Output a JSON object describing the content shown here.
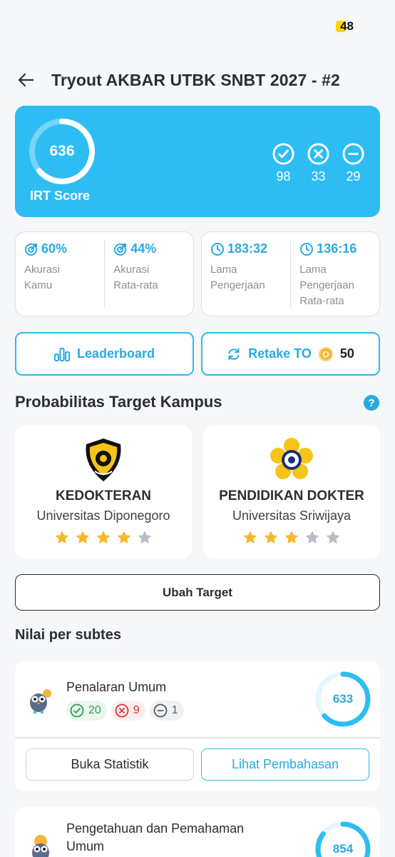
{
  "status_bar": {
    "battery": "48"
  },
  "header": {
    "title": "Tryout AKBAR UTBK SNBT 2027 - #2"
  },
  "score": {
    "value": "636",
    "label": "IRT Score",
    "ring_fraction": 0.636,
    "correct": "98",
    "wrong": "33",
    "skipped": "29"
  },
  "accuracy": {
    "yours_value": "60%",
    "yours_label_1": "Akurasi",
    "yours_label_2": "Kamu",
    "avg_value": "44%",
    "avg_label_1": "Akurasi",
    "avg_label_2": "Rata-rata"
  },
  "duration": {
    "yours_value": "183:32",
    "yours_label_1": "Lama",
    "yours_label_2": "Pengerjaan",
    "avg_value": "136:16",
    "avg_label_1": "Lama",
    "avg_label_2": "Pengerjaan",
    "avg_label_3": "Rata-rata"
  },
  "actions": {
    "leaderboard": "Leaderboard",
    "retake": "Retake TO",
    "retake_cost": "50"
  },
  "campus_section": {
    "title": "Probabilitas Target Kampus",
    "help": "?",
    "items": [
      {
        "major": "KEDOKTERAN",
        "university": "Universitas Diponegoro",
        "stars": 4,
        "max_stars": 5
      },
      {
        "major": "PENDIDIKAN DOKTER",
        "university": "Universitas Sriwijaya",
        "stars": 3,
        "max_stars": 5
      }
    ],
    "change_target": "Ubah Target"
  },
  "subtests": {
    "title": "Nilai per subtes",
    "items": [
      {
        "name": "Penalaran Umum",
        "correct": "20",
        "wrong": "9",
        "skipped": "1",
        "score": "633",
        "ring_fraction": 0.633,
        "stats_button": "Buka Statistik",
        "discussion_button": "Lihat Pembahasan"
      },
      {
        "name_line1": "Pengetahuan dan Pemahaman",
        "name_line2": "Umum",
        "score": "854",
        "ring_fraction": 0.854
      }
    ]
  },
  "colors": {
    "accent": "#2dbdf3",
    "accent_text": "#2aa9e0",
    "star_on": "#f5b82e",
    "star_off": "#b7bdc5"
  }
}
